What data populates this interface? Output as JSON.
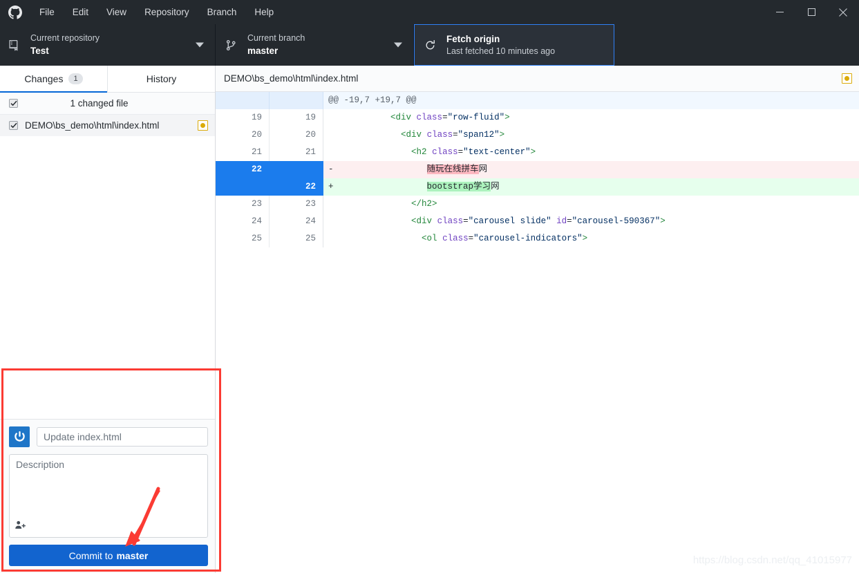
{
  "titlebar": {
    "logo_name": "github-logo",
    "menus": [
      "File",
      "Edit",
      "View",
      "Repository",
      "Branch",
      "Help"
    ],
    "window_controls": {
      "minimize": "—",
      "maximize": "❐",
      "close": "✕"
    }
  },
  "toolbar": {
    "repository": {
      "label": "Current repository",
      "value": "Test"
    },
    "branch": {
      "label": "Current branch",
      "value": "master"
    },
    "fetch": {
      "title": "Fetch origin",
      "subtitle": "Last fetched 10 minutes ago"
    }
  },
  "sidebar": {
    "tabs": [
      {
        "label": "Changes",
        "badge": "1",
        "active": true
      },
      {
        "label": "History",
        "badge": "",
        "active": false
      }
    ],
    "changed_summary": "1 changed file",
    "files": [
      {
        "path": "DEMO\\bs_demo\\html\\index.html",
        "status": "modified",
        "checked": true
      }
    ]
  },
  "commit_form": {
    "summary_placeholder": "Update index.html",
    "summary_value": "",
    "description_placeholder": "Description",
    "description_value": "",
    "commit_button_prefix": "Commit to",
    "commit_button_branch": "master",
    "avatar_name": "user-avatar",
    "coauthor_icon": "add-coauthor-icon"
  },
  "diff": {
    "file_path": "DEMO\\bs_demo\\html\\index.html",
    "status_icon": "modified-status-icon",
    "hunk_header": "@@ -19,7 +19,7 @@",
    "rows": [
      {
        "type": "hunk",
        "old": "",
        "new": "",
        "marker": "",
        "text": "@@ -19,7 +19,7 @@"
      },
      {
        "type": "ctx",
        "old": "19",
        "new": "19",
        "marker": "",
        "text": "            <div class=\"row-fluid\">"
      },
      {
        "type": "ctx",
        "old": "20",
        "new": "20",
        "marker": "",
        "text": "              <div class=\"span12\">"
      },
      {
        "type": "ctx",
        "old": "21",
        "new": "21",
        "marker": "",
        "text": "                <h2 class=\"text-center\">"
      },
      {
        "type": "del",
        "old": "22",
        "new": "",
        "marker": "-",
        "text": "                  随玩在线拼车网",
        "highlight": "随玩在线拼车"
      },
      {
        "type": "add",
        "old": "",
        "new": "22",
        "marker": "+",
        "text": "                  bootstrap学习网",
        "highlight": "bootstrap学习"
      },
      {
        "type": "ctx",
        "old": "23",
        "new": "23",
        "marker": "",
        "text": "                </h2>"
      },
      {
        "type": "ctx",
        "old": "24",
        "new": "24",
        "marker": "",
        "text": "                <div class=\"carousel slide\" id=\"carousel-590367\">"
      },
      {
        "type": "ctx",
        "old": "25",
        "new": "25",
        "marker": "",
        "text": "                  <ol class=\"carousel-indicators\">"
      }
    ]
  },
  "annotations": {
    "highlight_box_name": "commit-area-highlight",
    "arrow_name": "commit-button-arrow",
    "watermark": "https://blog.csdn.net/qq_41015977"
  },
  "colors": {
    "accent_blue": "#0366d6",
    "commit_blue": "#1264cf",
    "title_dark": "#24292e",
    "modified_yellow": "#dbab09",
    "annotation_red": "#fb3b33",
    "add_green": "#e6ffed",
    "del_red": "#fdeff0"
  }
}
